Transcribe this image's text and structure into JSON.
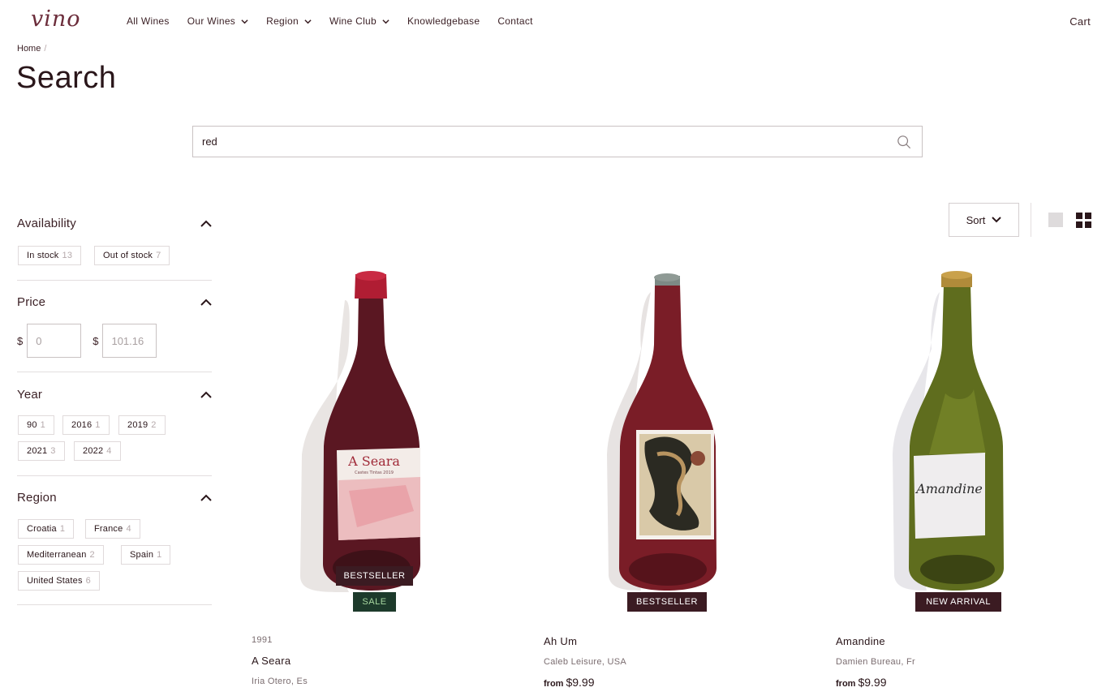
{
  "brand": {
    "logo_text": "vino"
  },
  "nav": {
    "items": [
      {
        "label": "All Wines",
        "dropdown": false
      },
      {
        "label": "Our Wines",
        "dropdown": true
      },
      {
        "label": "Region",
        "dropdown": true
      },
      {
        "label": "Wine Club",
        "dropdown": true
      },
      {
        "label": "Knowledgebase",
        "dropdown": false
      },
      {
        "label": "Contact",
        "dropdown": false
      }
    ],
    "cart_label": "Cart"
  },
  "breadcrumb": {
    "home": "Home",
    "separator": "/"
  },
  "page": {
    "title": "Search"
  },
  "search": {
    "value": "red",
    "icon": "search-icon"
  },
  "filters": {
    "availability": {
      "title": "Availability",
      "options": [
        {
          "label": "In stock",
          "count": "13"
        },
        {
          "label": "Out of stock",
          "count": "7"
        }
      ]
    },
    "price": {
      "title": "Price",
      "currency": "$",
      "min_placeholder": "0",
      "max_placeholder": "101.16"
    },
    "year": {
      "title": "Year",
      "options": [
        {
          "label": "90",
          "count": "1"
        },
        {
          "label": "2016",
          "count": "1"
        },
        {
          "label": "2019",
          "count": "2"
        },
        {
          "label": "2021",
          "count": "3"
        },
        {
          "label": "2022",
          "count": "4"
        }
      ]
    },
    "region": {
      "title": "Region",
      "options": [
        {
          "label": "Croatia",
          "count": "1"
        },
        {
          "label": "France",
          "count": "4"
        },
        {
          "label": "Mediterranean",
          "count": "2"
        },
        {
          "label": "Spain",
          "count": "1"
        },
        {
          "label": "United States",
          "count": "6"
        }
      ]
    }
  },
  "toolbar": {
    "sort_label": "Sort"
  },
  "products": [
    {
      "year": "1991",
      "name": "A Seara",
      "producer": "Iria Otero, Es",
      "badges": [
        "BESTSELLER",
        "SALE"
      ],
      "label_text": "A Seara",
      "label_sub": "Castes Tintas 2019"
    },
    {
      "name": "Ah Um",
      "producer": "Caleb Leisure, USA",
      "price_prefix": "from",
      "price": "$9.99",
      "badges": [
        "BESTSELLER"
      ]
    },
    {
      "name": "Amandine",
      "producer": "Damien Bureau, Fr",
      "price_prefix": "from",
      "price": "$9.99",
      "badges": [
        "NEW ARRIVAL"
      ],
      "label_text": "Amandine"
    }
  ],
  "colors": {
    "brand": "#6b2c3a",
    "text": "#3a1f24",
    "badge_dark": "#3b1b22",
    "badge_sale": "#1d3a2b"
  }
}
